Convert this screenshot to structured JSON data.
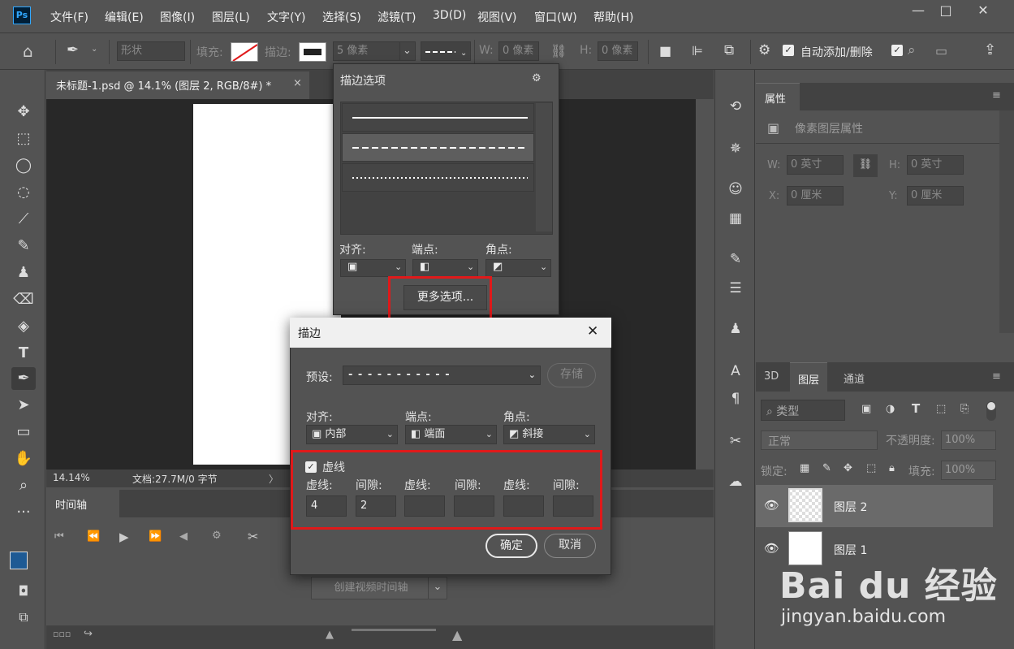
{
  "app": {
    "logo": "Ps"
  },
  "menu": [
    "文件(F)",
    "编辑(E)",
    "图像(I)",
    "图层(L)",
    "文字(Y)",
    "选择(S)",
    "滤镜(T)",
    "3D(D)",
    "视图(V)",
    "窗口(W)",
    "帮助(H)"
  ],
  "window_controls": {
    "minimize": "—",
    "maximize": "□",
    "close": "✕"
  },
  "options_bar": {
    "mode": "形状",
    "fill_label": "填充:",
    "stroke_label": "描边:",
    "stroke_width": "5 像素",
    "w_label": "W:",
    "w_value": "0 像素",
    "h_label": "H:",
    "h_value": "0 像素",
    "auto_add_delete": "自动添加/删除"
  },
  "document": {
    "tab_title": "未标题-1.psd @ 14.1% (图层 2, RGB/8#) *",
    "zoom": "14.14%",
    "doc_info": "文档:27.7M/0 字节"
  },
  "stroke_popup": {
    "title": "描边选项",
    "align_label": "对齐:",
    "caps_label": "端点:",
    "corners_label": "角点:",
    "more_options": "更多选项..."
  },
  "dialog": {
    "title": "描边",
    "preset_label": "预设:",
    "preset_value": "- - - - - - - - - - -",
    "save_button": "存储",
    "align_label": "对齐:",
    "align_value": "内部",
    "caps_label": "端点:",
    "caps_value": "端面",
    "corners_label": "角点:",
    "corners_value": "斜接",
    "dashed_label": "虚线",
    "dashed_checked": true,
    "dash_headers": [
      "虚线:",
      "间隙:",
      "虚线:",
      "间隙:",
      "虚线:",
      "间隙:"
    ],
    "dash_values": [
      "4",
      "2",
      "",
      "",
      "",
      ""
    ],
    "ok_button": "确定",
    "cancel_button": "取消"
  },
  "timeline": {
    "tab": "时间轴",
    "create_button": "创建视频时间轴"
  },
  "properties": {
    "tab": "属性",
    "subtitle": "像素图层属性",
    "w_label": "W:",
    "w_value": "0 英寸",
    "h_label": "H:",
    "h_value": "0 英寸",
    "x_label": "X:",
    "x_value": "0 厘米",
    "y_label": "Y:",
    "y_value": "0 厘米"
  },
  "layers_panel": {
    "tabs": [
      "3D",
      "图层",
      "通道"
    ],
    "filter_label": "类型",
    "blend_mode": "正常",
    "opacity_label": "不透明度:",
    "opacity_value": "100%",
    "lock_label": "锁定:",
    "fill_label": "填充:",
    "fill_value": "100%",
    "layers": [
      {
        "name": "图层 2",
        "selected": true,
        "thumb": "transparent"
      },
      {
        "name": "图层 1",
        "selected": false,
        "thumb": "white"
      }
    ]
  },
  "watermark": {
    "brand": "Bai du 经验",
    "url": "jingyan.baidu.com"
  },
  "colors": {
    "foreground": "#1e5a94",
    "background": "#25d0e8",
    "highlight": "#e0191a"
  }
}
